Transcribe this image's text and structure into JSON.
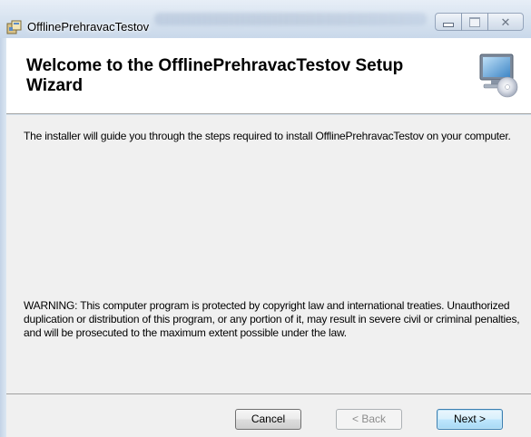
{
  "window": {
    "title": "OfflinePrehravacTestov"
  },
  "header": {
    "title": "Welcome to the OfflinePrehravacTestov Setup Wizard",
    "icon": "computer-cd-icon"
  },
  "body": {
    "intro": "The installer will guide you through the steps required to install OfflinePrehravacTestov on your computer.",
    "warning": "WARNING: This computer program is protected by copyright law and international treaties. Unauthorized duplication or distribution of this program, or any portion of it, may result in severe civil or criminal penalties, and will be prosecuted to the maximum extent possible under the law."
  },
  "buttons": {
    "cancel": "Cancel",
    "back": "< Back",
    "next": "Next >"
  },
  "caption_buttons": {
    "minimize": "minimize-icon",
    "maximize": "maximize-icon",
    "close": "close-icon"
  }
}
